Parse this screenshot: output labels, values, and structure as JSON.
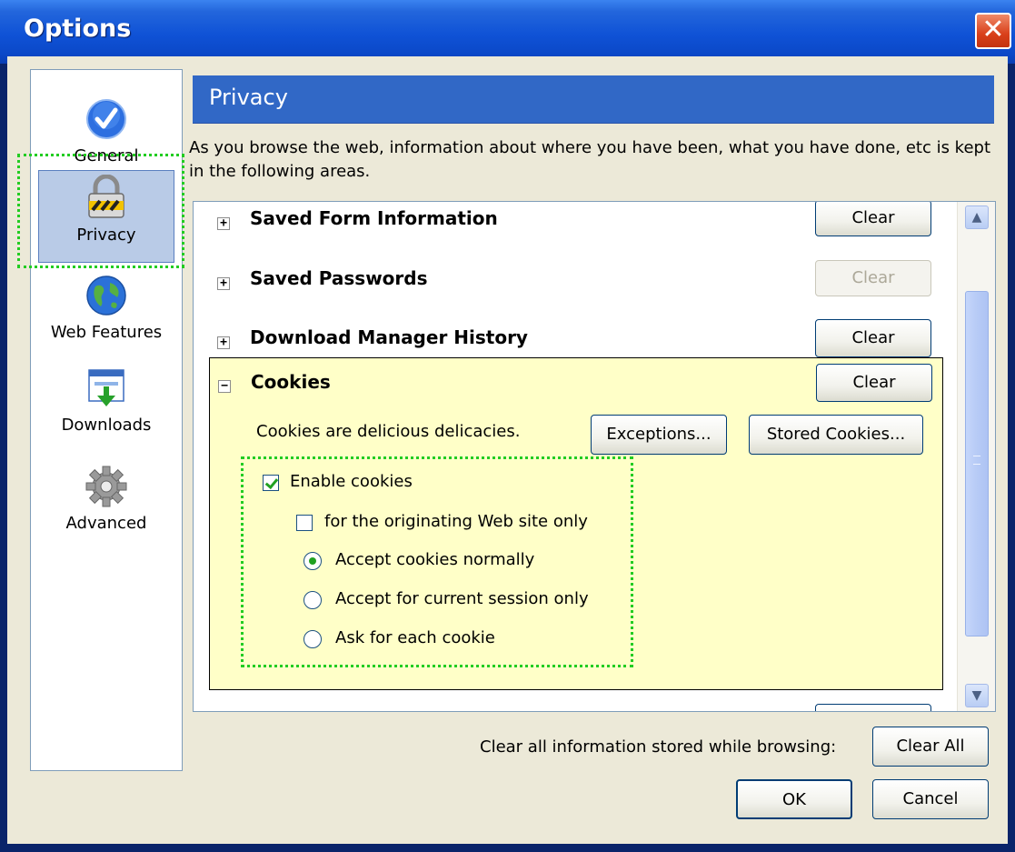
{
  "window": {
    "title": "Options",
    "close_glyph": "✕"
  },
  "sidebar": {
    "items": [
      {
        "label": "General",
        "icon": "checkmark-icon",
        "selected": false
      },
      {
        "label": "Privacy",
        "icon": "lock-icon",
        "selected": true
      },
      {
        "label": "Web Features",
        "icon": "globe-icon",
        "selected": false
      },
      {
        "label": "Downloads",
        "icon": "download-icon",
        "selected": false
      },
      {
        "label": "Advanced",
        "icon": "gear-icon",
        "selected": false
      }
    ]
  },
  "panel": {
    "title": "Privacy",
    "description": "As you browse the web, information about where you have been, what you have done, etc is kept in the following areas."
  },
  "sections": [
    {
      "title": "Saved Form Information",
      "expander": "+",
      "button": "Clear",
      "button_enabled": true
    },
    {
      "title": "Saved Passwords",
      "expander": "+",
      "button": "Clear",
      "button_enabled": false
    },
    {
      "title": "Download Manager History",
      "expander": "+",
      "button": "Clear",
      "button_enabled": true
    },
    {
      "title": "Cookies",
      "expander": "−",
      "button": "Clear",
      "button_enabled": true
    }
  ],
  "cookies": {
    "description": "Cookies are delicious delicacies.",
    "exceptions_button": "Exceptions...",
    "stored_button": "Stored Cookies...",
    "enable_label": "Enable cookies",
    "enable_checked": true,
    "originating_label": "for the originating Web site only",
    "originating_checked": false,
    "radio_options": [
      {
        "label": "Accept cookies normally",
        "selected": true
      },
      {
        "label": "Accept for current session only",
        "selected": false
      },
      {
        "label": "Ask for each cookie",
        "selected": false
      }
    ]
  },
  "footer": {
    "clear_all_text": "Clear all information stored while browsing:",
    "clear_all_button": "Clear All",
    "ok_button": "OK",
    "cancel_button": "Cancel"
  },
  "colors": {
    "titlebar": "#0b48c8",
    "header": "#3168c6",
    "focus_ring": "#22cc22",
    "cookies_bg": "#ffffc8"
  }
}
